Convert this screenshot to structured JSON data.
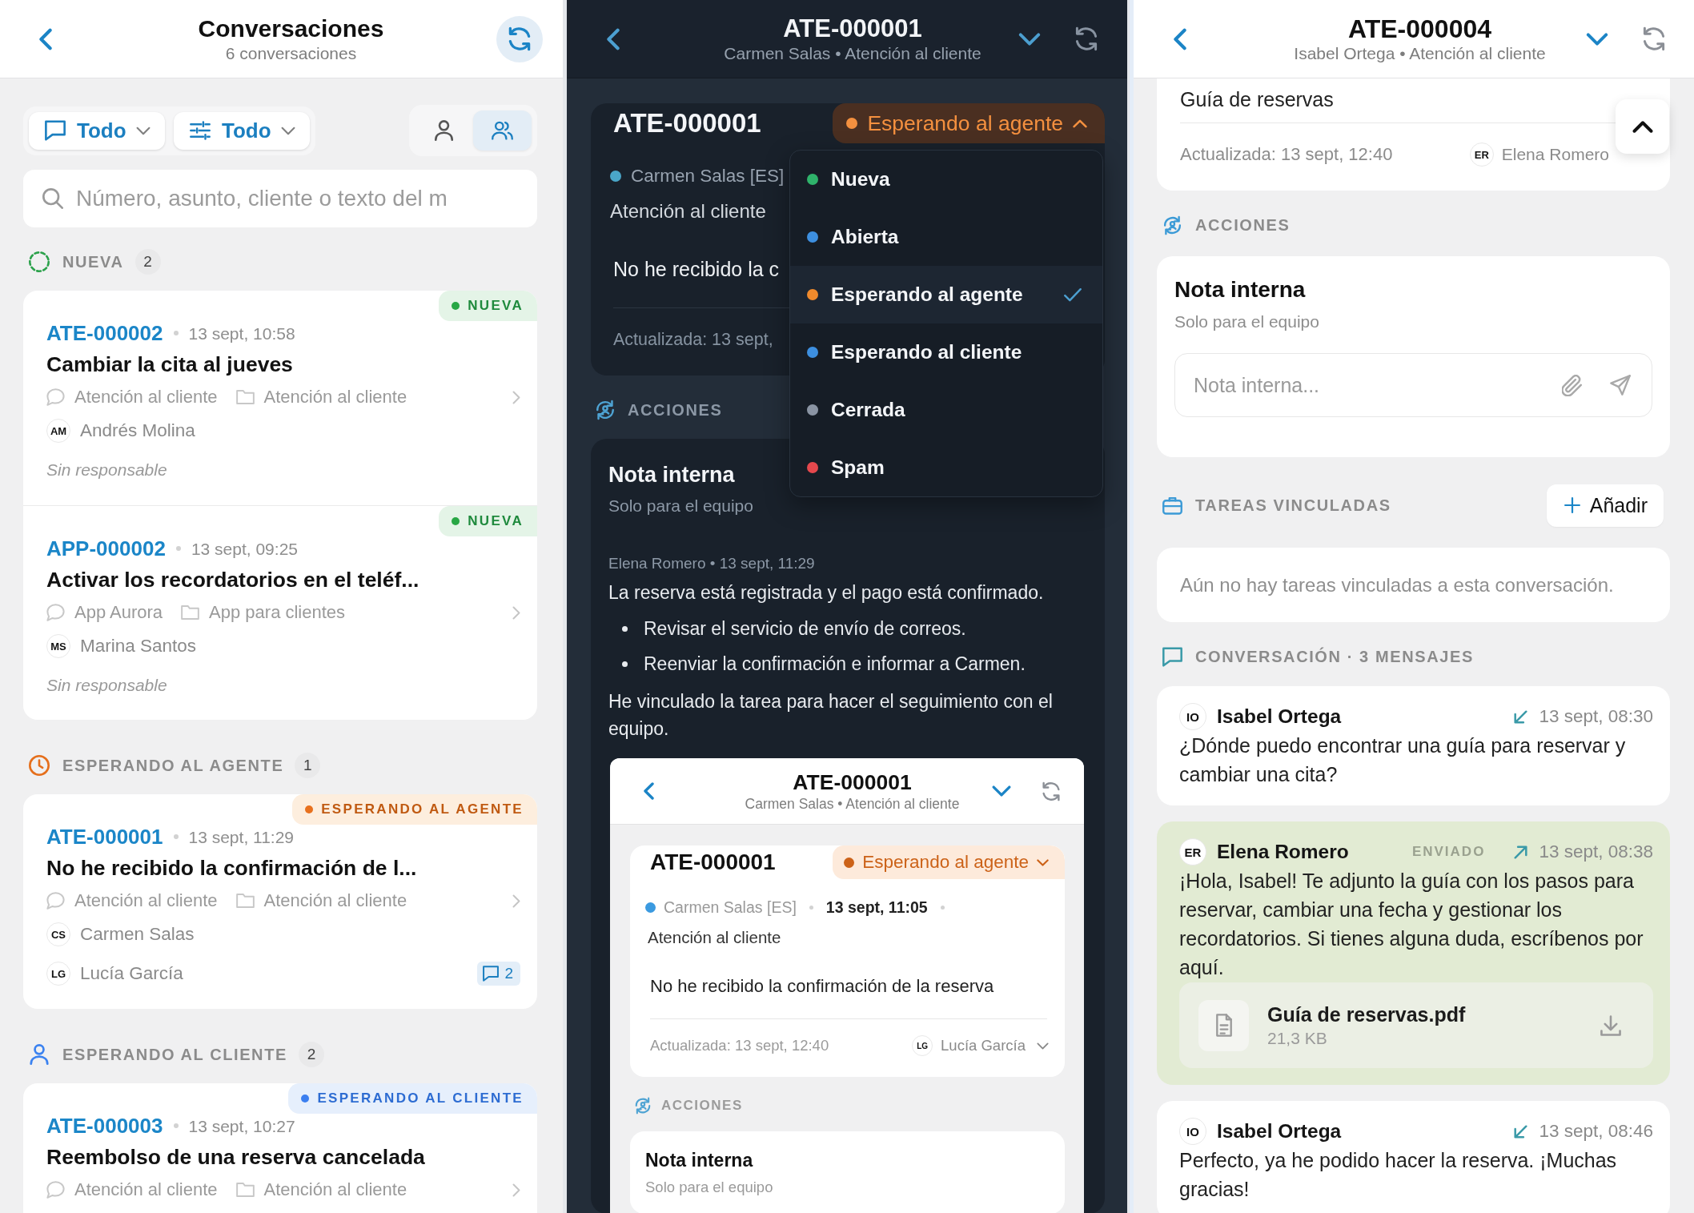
{
  "conversation_list": {
    "header": {
      "title": "Conversaciones",
      "subtitle": "6 conversaciones"
    },
    "filters": [
      {
        "kind": "channel",
        "label": "Todo"
      },
      {
        "kind": "status",
        "label": "Todo"
      }
    ],
    "view_toggle": [
      {
        "kind": "single",
        "selected": false
      },
      {
        "kind": "team",
        "selected": true
      }
    ],
    "search": {
      "placeholder": "Número, asunto, cliente o texto del m"
    },
    "groups": [
      {
        "kind": "new",
        "title": "NUEVA",
        "count": "2",
        "items": [
          {
            "id": "ATE-000002",
            "time": "13 sept, 10:58",
            "title": "Cambiar la cita al jueves",
            "badge": "NUEVA",
            "channel": "Atención al cliente",
            "team": "Atención al cliente",
            "contact": {
              "initials": "AM",
              "name": "Andrés Molina"
            },
            "assignee": {
              "kind": "none",
              "label": "Sin responsable"
            }
          },
          {
            "id": "APP-000002",
            "time": "13 sept, 09:25",
            "title": "Activar los recordatorios en el teléf...",
            "badge": "NUEVA",
            "channel": "App Aurora",
            "team": "App para clientes",
            "contact": {
              "initials": "MS",
              "name": "Marina Santos"
            },
            "assignee": {
              "kind": "none",
              "label": "Sin responsable"
            }
          }
        ]
      },
      {
        "kind": "waiting_agent",
        "title": "ESPERANDO AL AGENTE",
        "count": "1",
        "items": [
          {
            "id": "ATE-000001",
            "time": "13 sept, 11:29",
            "title": "No he recibido la confirmación de l...",
            "badge": "ESPERANDO AL AGENTE",
            "channel": "Atención al cliente",
            "team": "Atención al cliente",
            "contact": {
              "initials": "CS",
              "name": "Carmen Salas"
            },
            "assignee": {
              "kind": "agent",
              "initials": "LG",
              "name": "Lucía García"
            },
            "comments": "2"
          }
        ]
      },
      {
        "kind": "waiting_client",
        "title": "ESPERANDO AL CLIENTE",
        "count": "2",
        "items": [
          {
            "id": "ATE-000003",
            "time": "13 sept, 10:27",
            "title": "Reembolso de una reserva cancelada",
            "badge": "ESPERANDO AL CLIENTE",
            "channel": "Atención al cliente",
            "team": "Atención al cliente"
          }
        ]
      }
    ]
  },
  "ticket_view_dark": {
    "header": {
      "title": "ATE-000001",
      "subtitle": "Carmen Salas • Atención al cliente"
    },
    "ticket": {
      "id": "ATE-000001",
      "status": {
        "kind": "waiting_agent",
        "label": "Esperando al agente",
        "expanded": true
      },
      "contact": "Carmen Salas [ES]",
      "team": "Atención al cliente",
      "subject": "No he recibido la c",
      "updated": "Actualizada: 13 sept,"
    },
    "status_menu": [
      {
        "label": "Nueva",
        "color": "#2fb36b",
        "selected": false
      },
      {
        "label": "Abierta",
        "color": "#3d8fe0",
        "selected": false
      },
      {
        "label": "Esperando al agente",
        "color": "#f08a2c",
        "selected": true
      },
      {
        "label": "Esperando al cliente",
        "color": "#3d8fe0",
        "selected": false
      },
      {
        "label": "Cerrada",
        "color": "#8a94a3",
        "selected": false
      },
      {
        "label": "Spam",
        "color": "#e5484d",
        "selected": false
      }
    ],
    "actions_title": "ACCIONES",
    "note": {
      "title": "Nota interna",
      "subtitle": "Solo para el equipo",
      "meta": "Elena Romero • 13 sept, 11:29",
      "body": [
        {
          "kind": "paragraph",
          "text": "La reserva está registrada y el pago está confirmado."
        },
        {
          "kind": "bullet",
          "text": "Revisar el servicio de envío de correos."
        },
        {
          "kind": "bullet",
          "text": "Reenviar la confirmación e informar a Carmen."
        },
        {
          "kind": "paragraph",
          "text": "He vinculado la tarea para hacer el seguimiento con el equipo."
        }
      ],
      "screenshot": {
        "header": {
          "title": "ATE-000001",
          "subtitle": "Carmen Salas • Atención al cliente"
        },
        "ticket": {
          "id": "ATE-000001",
          "status": {
            "kind": "waiting_agent",
            "label": "Esperando al agente",
            "expanded": false
          },
          "contact": "Carmen Salas [ES]",
          "time": "13 sept, 11:05",
          "team": "Atención al cliente",
          "subject": "No he recibido la confirmación de la reserva",
          "updated": "Actualizada: 13 sept, 12:40",
          "assignee": {
            "initials": "LG",
            "name": "Lucía García"
          }
        },
        "actions_title": "ACCIONES",
        "note": {
          "title": "Nota interna",
          "subtitle": "Solo para el equipo"
        }
      }
    }
  },
  "ticket_view_light": {
    "header": {
      "title": "ATE-000004",
      "subtitle": "Isabel Ortega • Atención al cliente"
    },
    "ticket": {
      "subject": "Guía de reservas",
      "updated": "Actualizada: 13 sept, 12:40",
      "assignee": {
        "initials": "ER",
        "name": "Elena Romero"
      }
    },
    "actions_title": "ACCIONES",
    "note": {
      "title": "Nota interna",
      "subtitle": "Solo para el equipo",
      "placeholder": "Nota interna..."
    },
    "tasks": {
      "title": "TAREAS VINCULADAS",
      "add_label": "Añadir",
      "empty": "Aún no hay tareas vinculadas a esta conversación."
    },
    "conversation": {
      "title": "CONVERSACIÓN · 3 MENSAJES",
      "messages": [
        {
          "kind": "incoming",
          "initials": "IO",
          "author": "Isabel Ortega",
          "time": "13 sept, 08:30",
          "text": "¿Dónde puedo encontrar una guía para reservar y cambiar una cita?"
        },
        {
          "kind": "outgoing",
          "initials": "ER",
          "author": "Elena Romero",
          "status": "ENVIADO",
          "time": "13 sept, 08:38",
          "text": "¡Hola, Isabel! Te adjunto la guía con los pasos para reservar, cambiar una fecha y gestionar los recordatorios. Si tienes alguna duda, escríbenos por aquí.",
          "attachment": {
            "name": "Guía de reservas.pdf",
            "size": "21,3 KB"
          }
        },
        {
          "kind": "incoming",
          "initials": "IO",
          "author": "Isabel Ortega",
          "time": "13 sept, 08:46",
          "text": "Perfecto, ya he podido hacer la reserva. ¡Muchas gracias!"
        }
      ]
    }
  }
}
